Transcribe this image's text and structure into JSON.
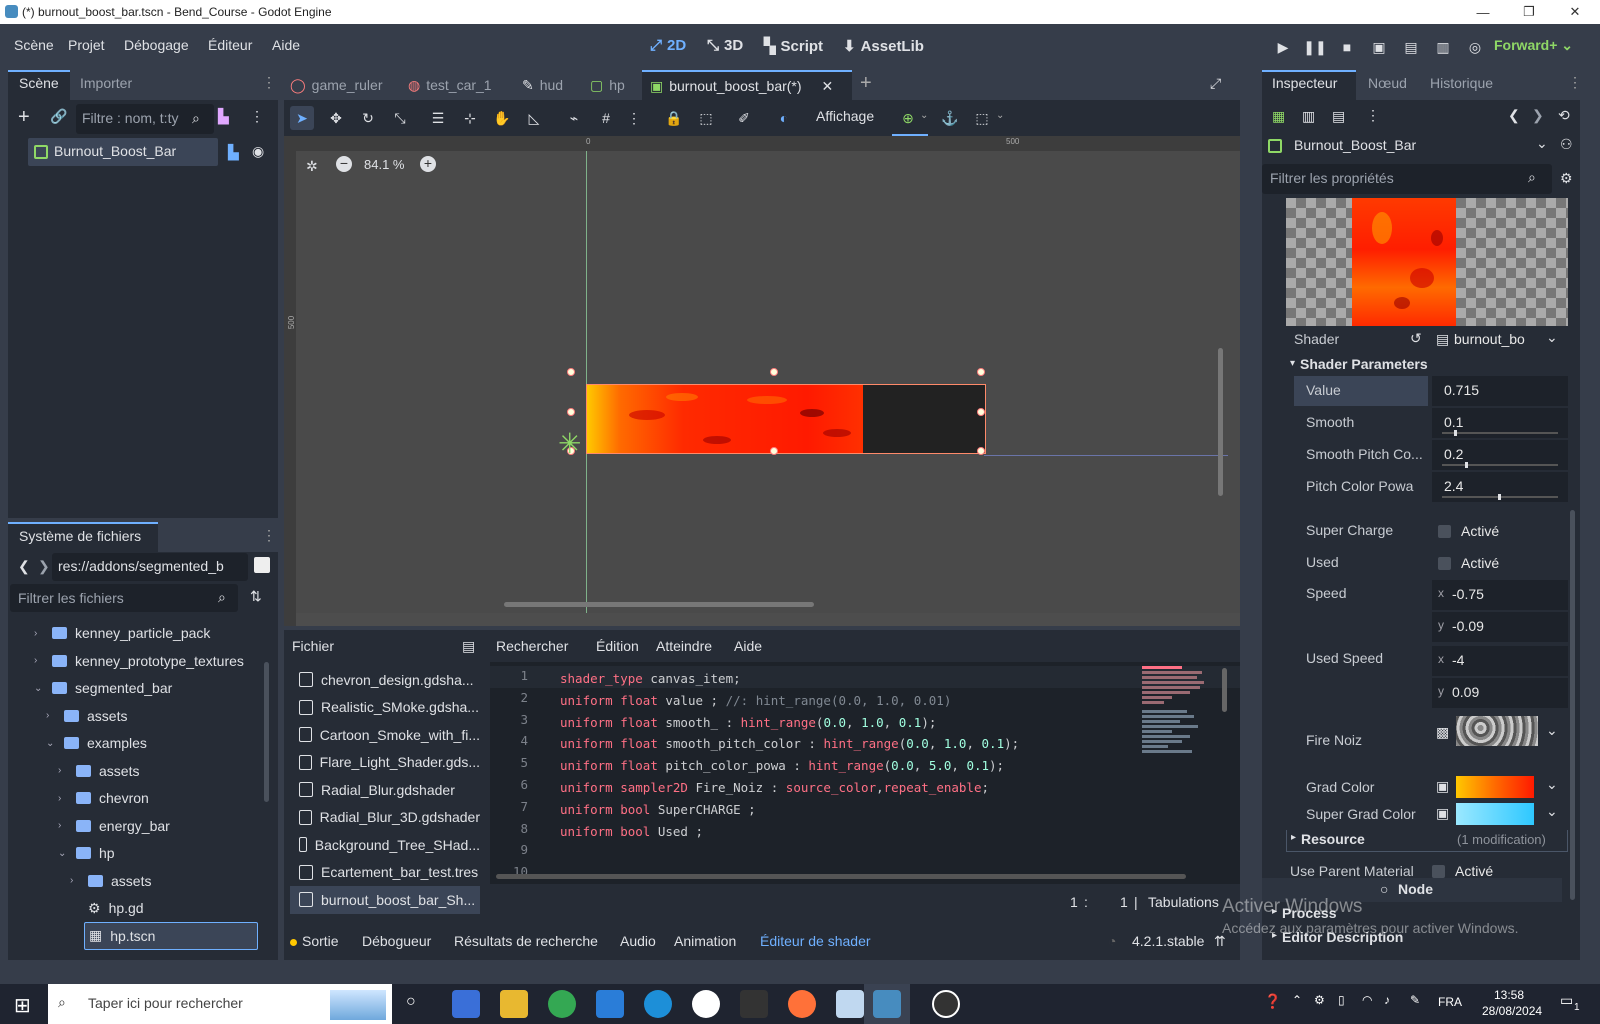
{
  "window": {
    "title": "(*) burnout_boost_bar.tscn - Bend_Course - Godot Engine",
    "controls": [
      "—",
      "❐",
      "✕"
    ]
  },
  "menu": {
    "items": [
      "Scène",
      "Projet",
      "Débogage",
      "Éditeur",
      "Aide"
    ],
    "workspaces": [
      "2D",
      "3D",
      "Script",
      "AssetLib"
    ],
    "renderer": "Forward+"
  },
  "scene_dock": {
    "tabs": [
      "Scène",
      "Importer"
    ],
    "filter_placeholder": "Filtre : nom, t:ty",
    "root_node": "Burnout_Boost_Bar"
  },
  "filesystem": {
    "title": "Système de fichiers",
    "path": "res://addons/segmented_b",
    "filter_placeholder": "Filtrer les fichiers",
    "tree": [
      {
        "label": "kenney_particle_pack",
        "depth": 1,
        "type": "folder",
        "open": false
      },
      {
        "label": "kenney_prototype_textures",
        "depth": 1,
        "type": "folder",
        "open": false
      },
      {
        "label": "segmented_bar",
        "depth": 1,
        "type": "folder",
        "open": true
      },
      {
        "label": "assets",
        "depth": 2,
        "type": "folder",
        "open": false
      },
      {
        "label": "examples",
        "depth": 2,
        "type": "folder",
        "open": true
      },
      {
        "label": "assets",
        "depth": 3,
        "type": "folder",
        "open": false
      },
      {
        "label": "chevron",
        "depth": 3,
        "type": "folder",
        "open": false
      },
      {
        "label": "energy_bar",
        "depth": 3,
        "type": "folder",
        "open": false
      },
      {
        "label": "hp",
        "depth": 3,
        "type": "folder",
        "open": true
      },
      {
        "label": "assets",
        "depth": 4,
        "type": "folder",
        "open": false
      },
      {
        "label": "hp.gd",
        "depth": 4,
        "type": "gear",
        "open": false
      },
      {
        "label": "hp.tscn",
        "depth": 4,
        "type": "scene",
        "open": false,
        "selected": true
      }
    ]
  },
  "scene_tabs": {
    "tabs": [
      "game_ruler",
      "test_car_1",
      "hud",
      "hp",
      "burnout_boost_bar(*)"
    ],
    "active": 4
  },
  "viewport_toolbar": {
    "view_label": "Affichage",
    "zoom": "84.1 %",
    "ruler_marks": [
      "0",
      "500"
    ],
    "ruler_v_mark": "500"
  },
  "shader_editor": {
    "menu": [
      "Fichier",
      "Rechercher",
      "Édition",
      "Atteindre",
      "Aide"
    ],
    "files": [
      "chevron_design.gdsha...",
      "Realistic_SMoke.gdsha...",
      "Cartoon_Smoke_with_fi...",
      "Flare_Light_Shader.gds...",
      "Radial_Blur.gdshader",
      "Radial_Blur_3D.gdshader",
      "Background_Tree_SHad...",
      "Ecartement_bar_test.tres",
      "burnout_boost_bar_Sh..."
    ],
    "selected_file": 8,
    "line_numbers": [
      "1",
      "2",
      "3",
      "4",
      "5",
      "6",
      "7",
      "8",
      "9",
      "10"
    ],
    "status_line": "1",
    "status_col": "1",
    "status_indent": "Tabulations"
  },
  "bottom_panel": {
    "tabs": [
      "Sortie",
      "Débogueur",
      "Résultats de recherche",
      "Audio",
      "Animation",
      "Éditeur de shader"
    ],
    "version": "4.2.1.stable"
  },
  "inspector": {
    "tabs": [
      "Inspecteur",
      "Nœud",
      "Historique"
    ],
    "node_name": "Burnout_Boost_Bar",
    "filter_placeholder": "Filtrer les propriétés",
    "shader_label": "Shader",
    "shader_value": "burnout_bo",
    "section_title": "Shader Parameters",
    "params": [
      {
        "label": "Value",
        "value": "0.715",
        "highlight": true
      },
      {
        "label": "Smooth",
        "value": "0.1",
        "slider": 0.1
      },
      {
        "label": "Smooth Pitch Co...",
        "value": "0.2",
        "slider": 0.2
      },
      {
        "label": "Pitch Color Powa",
        "value": "2.4",
        "slider": 0.48
      }
    ],
    "super_charge": {
      "label": "Super Charge",
      "check_label": "Activé"
    },
    "used": {
      "label": "Used",
      "check_label": "Activé"
    },
    "speed": {
      "label": "Speed",
      "x": "-0.75",
      "y": "-0.09"
    },
    "used_speed": {
      "label": "Used Speed",
      "x": "-4",
      "y": "0.09"
    },
    "axis_x": "x",
    "axis_y": "y",
    "fire_noiz": {
      "label": "Fire Noiz"
    },
    "grad_color": {
      "label": "Grad Color"
    },
    "super_grad_color": {
      "label": "Super Grad Color"
    },
    "resource": {
      "label": "Resource",
      "note": "(1 modification)"
    },
    "use_parent_material": {
      "label": "Use Parent Material",
      "check_label": "Activé"
    },
    "node_section": "Node",
    "process_section": "Process",
    "editor_description": "Editor Description"
  },
  "watermark": {
    "title": "Activer Windows",
    "subtitle": "Accédez aux paramètres pour activer Windows."
  },
  "taskbar": {
    "search_placeholder": "Taper ici pour rechercher",
    "lang": "FRA",
    "time": "13:58",
    "date": "28/08/2024",
    "notif_count": "1"
  },
  "colors": {
    "bg": "#363d4a",
    "panel": "#262c36",
    "accent": "#6fb0ff",
    "fire_red": "#ff2a00",
    "fire_yellow": "#ffc800"
  }
}
